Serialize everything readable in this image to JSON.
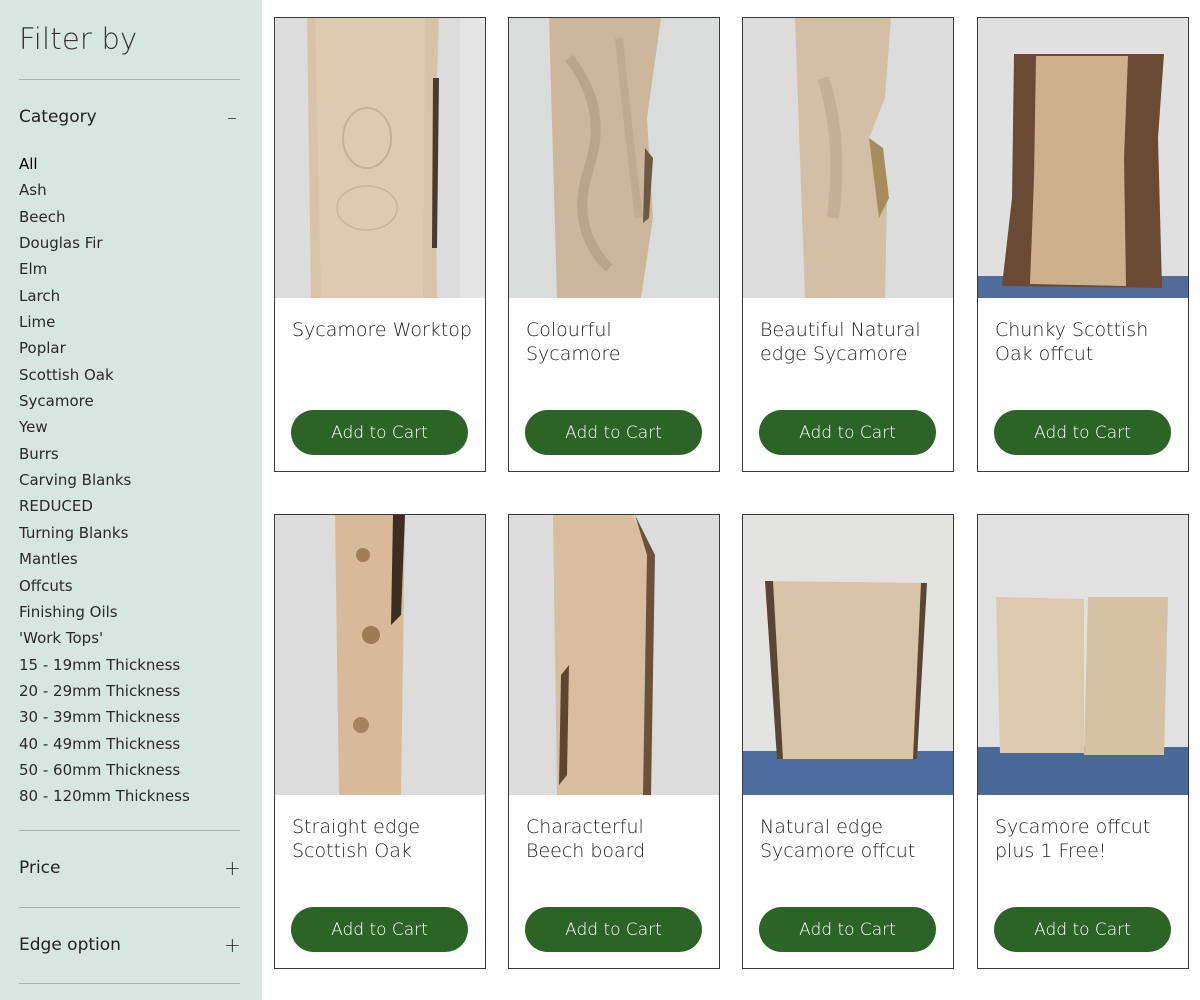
{
  "sidebar": {
    "title": "Filter by",
    "category": {
      "label": "Category",
      "toggle": "–",
      "items": [
        "All",
        "Ash",
        "Beech",
        "Douglas Fir",
        "Elm",
        "Larch",
        "Lime",
        "Poplar",
        "Scottish Oak",
        "Sycamore",
        "Yew",
        "Burrs",
        "Carving Blanks",
        "REDUCED",
        "Turning Blanks",
        "Mantles",
        "Offcuts",
        "Finishing Oils",
        "'Work Tops'",
        "15 - 19mm Thickness",
        "20 - 29mm Thickness",
        "30 - 39mm Thickness",
        "40 - 49mm Thickness",
        "50 - 60mm Thickness",
        "80 - 120mm Thickness"
      ],
      "selected": "All"
    },
    "price": {
      "label": "Price",
      "toggle": "+"
    },
    "edge_option": {
      "label": "Edge option",
      "toggle": "+"
    }
  },
  "products": [
    {
      "name": "Sycamore Worktop",
      "button": "Add to Cart"
    },
    {
      "name": "Colourful Sycamore",
      "button": "Add to Cart"
    },
    {
      "name": "Beautiful Natural edge Sycamore",
      "button": "Add to Cart"
    },
    {
      "name": "Chunky Scottish Oak offcut",
      "button": "Add to Cart"
    },
    {
      "name": "Straight edge Scottish Oak",
      "button": "Add to Cart"
    },
    {
      "name": "Characterful Beech board",
      "button": "Add to Cart"
    },
    {
      "name": "Natural edge Sycamore offcut",
      "button": "Add to Cart"
    },
    {
      "name": "Sycamore offcut plus 1 Free!",
      "button": "Add to Cart"
    }
  ],
  "colors": {
    "sidebar_bg": "#d8e6e1",
    "button_bg": "#2c6428",
    "button_text": "#ffffff",
    "card_border": "#3a3a3a"
  }
}
